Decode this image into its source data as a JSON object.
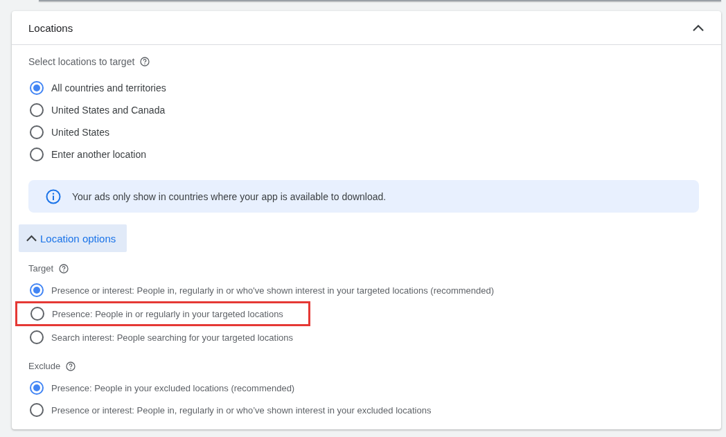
{
  "section": {
    "title": "Locations",
    "expanded": true
  },
  "location_targeting": {
    "label": "Select locations to target",
    "options": [
      {
        "label": "All countries and territories",
        "selected": true
      },
      {
        "label": "United States and Canada",
        "selected": false
      },
      {
        "label": "United States",
        "selected": false
      },
      {
        "label": "Enter another location",
        "selected": false
      }
    ]
  },
  "info_banner": {
    "text": "Your ads only show in countries where your app is available to download."
  },
  "location_options": {
    "label": "Location options",
    "expanded": true,
    "target": {
      "label": "Target",
      "options": [
        {
          "label": "Presence or interest: People in, regularly in or who've shown interest in your targeted locations (recommended)",
          "selected": true,
          "highlighted": false
        },
        {
          "label": "Presence: People in or regularly in your targeted locations",
          "selected": false,
          "highlighted": true
        },
        {
          "label": "Search interest: People searching for your targeted locations",
          "selected": false,
          "highlighted": false
        }
      ]
    },
    "exclude": {
      "label": "Exclude",
      "options": [
        {
          "label": "Presence: People in your excluded locations (recommended)",
          "selected": true,
          "highlighted": false
        },
        {
          "label": "Presence or interest: People in, regularly in or who’ve shown interest in your excluded locations",
          "selected": false,
          "highlighted": false
        }
      ]
    }
  }
}
